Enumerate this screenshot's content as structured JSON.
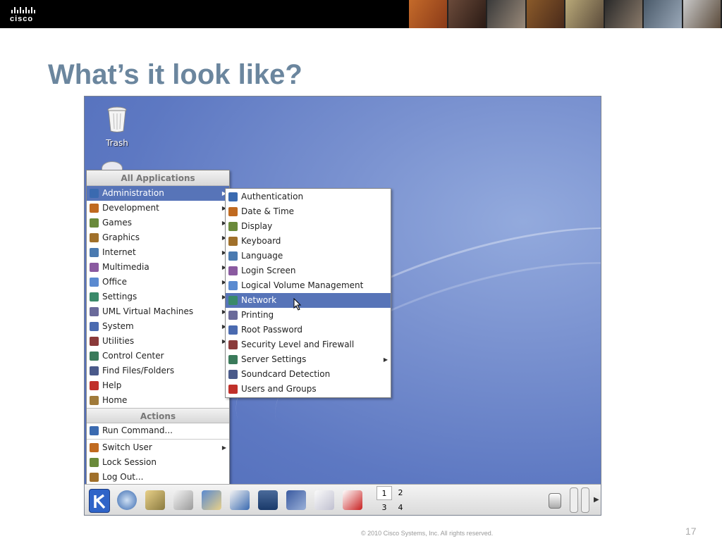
{
  "slide": {
    "logo_text": "cisco",
    "title": "What’s it look like?",
    "copyright": "© 2010 Cisco Systems, Inc. All rights reserved.",
    "page_number": "17"
  },
  "desktop": {
    "icons": [
      {
        "label": "Trash",
        "icon": "trash-icon"
      }
    ]
  },
  "main_menu": {
    "header": "All Applications",
    "items": [
      {
        "label": "Administration",
        "icon": "administration-icon",
        "submenu": true,
        "selected": true
      },
      {
        "label": "Development",
        "icon": "development-icon",
        "submenu": true
      },
      {
        "label": "Games",
        "icon": "games-icon",
        "submenu": true
      },
      {
        "label": "Graphics",
        "icon": "graphics-icon",
        "submenu": true
      },
      {
        "label": "Internet",
        "icon": "internet-icon",
        "submenu": true
      },
      {
        "label": "Multimedia",
        "icon": "multimedia-icon",
        "submenu": true
      },
      {
        "label": "Office",
        "icon": "office-icon",
        "submenu": true
      },
      {
        "label": "Settings",
        "icon": "settings-icon",
        "submenu": true
      },
      {
        "label": "UML Virtual Machines",
        "icon": "uml-icon",
        "submenu": true
      },
      {
        "label": "System",
        "icon": "system-icon",
        "submenu": true
      },
      {
        "label": "Utilities",
        "icon": "utilities-icon",
        "submenu": true
      },
      {
        "label": "Control Center",
        "icon": "control-center-icon",
        "submenu": false
      },
      {
        "label": "Find Files/Folders",
        "icon": "find-icon",
        "submenu": false
      },
      {
        "label": "Help",
        "icon": "help-icon",
        "submenu": false
      },
      {
        "label": "Home",
        "icon": "home-icon",
        "submenu": false
      }
    ],
    "actions_header": "Actions",
    "actions": [
      {
        "label": "Run Command...",
        "icon": "run-icon",
        "submenu": false
      },
      {
        "label": "Switch User",
        "icon": "switch-user-icon",
        "submenu": true
      },
      {
        "label": "Lock Session",
        "icon": "lock-icon",
        "submenu": false
      },
      {
        "label": "Log Out...",
        "icon": "logout-icon",
        "submenu": false
      }
    ]
  },
  "submenu": {
    "items": [
      {
        "label": "Authentication",
        "icon": "authentication-icon",
        "submenu": false
      },
      {
        "label": "Date & Time",
        "icon": "clock-icon",
        "submenu": false
      },
      {
        "label": "Display",
        "icon": "display-icon",
        "submenu": false
      },
      {
        "label": "Keyboard",
        "icon": "keyboard-icon",
        "submenu": false
      },
      {
        "label": "Language",
        "icon": "language-icon",
        "submenu": false
      },
      {
        "label": "Login Screen",
        "icon": "login-screen-icon",
        "submenu": false
      },
      {
        "label": "Logical Volume Management",
        "icon": "lvm-icon",
        "submenu": false
      },
      {
        "label": "Network",
        "icon": "network-icon",
        "submenu": false,
        "selected": true
      },
      {
        "label": "Printing",
        "icon": "printer-icon",
        "submenu": false
      },
      {
        "label": "Root Password",
        "icon": "root-password-icon",
        "submenu": false
      },
      {
        "label": "Security Level and Firewall",
        "icon": "firewall-icon",
        "submenu": false
      },
      {
        "label": "Server Settings",
        "icon": "server-icon",
        "submenu": true
      },
      {
        "label": "Soundcard Detection",
        "icon": "soundcard-icon",
        "submenu": false
      },
      {
        "label": "Users and Groups",
        "icon": "users-icon",
        "submenu": false
      }
    ]
  },
  "taskbar": {
    "pager": [
      "1",
      "2",
      "3",
      "4"
    ]
  },
  "colors": {
    "selection": "#5774b8",
    "title": "#6b869e",
    "desktop": "#5d78c2"
  }
}
